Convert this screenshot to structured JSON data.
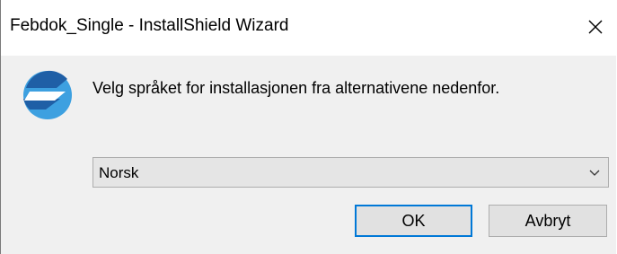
{
  "window": {
    "title": "Febdok_Single - InstallShield Wizard"
  },
  "icons": {
    "close": "close-icon",
    "logo": "installshield-logo-icon",
    "dropdown": "chevron-down-icon"
  },
  "dialog": {
    "prompt": "Velg språket for installasjonen fra alternativene nedenfor.",
    "language_select": {
      "selected": "Norsk"
    },
    "ok_label": "OK",
    "cancel_label": "Avbryt"
  },
  "colors": {
    "accent": "#0078d7",
    "logo_dark": "#1f5fa6",
    "logo_light": "#3da0e0"
  }
}
